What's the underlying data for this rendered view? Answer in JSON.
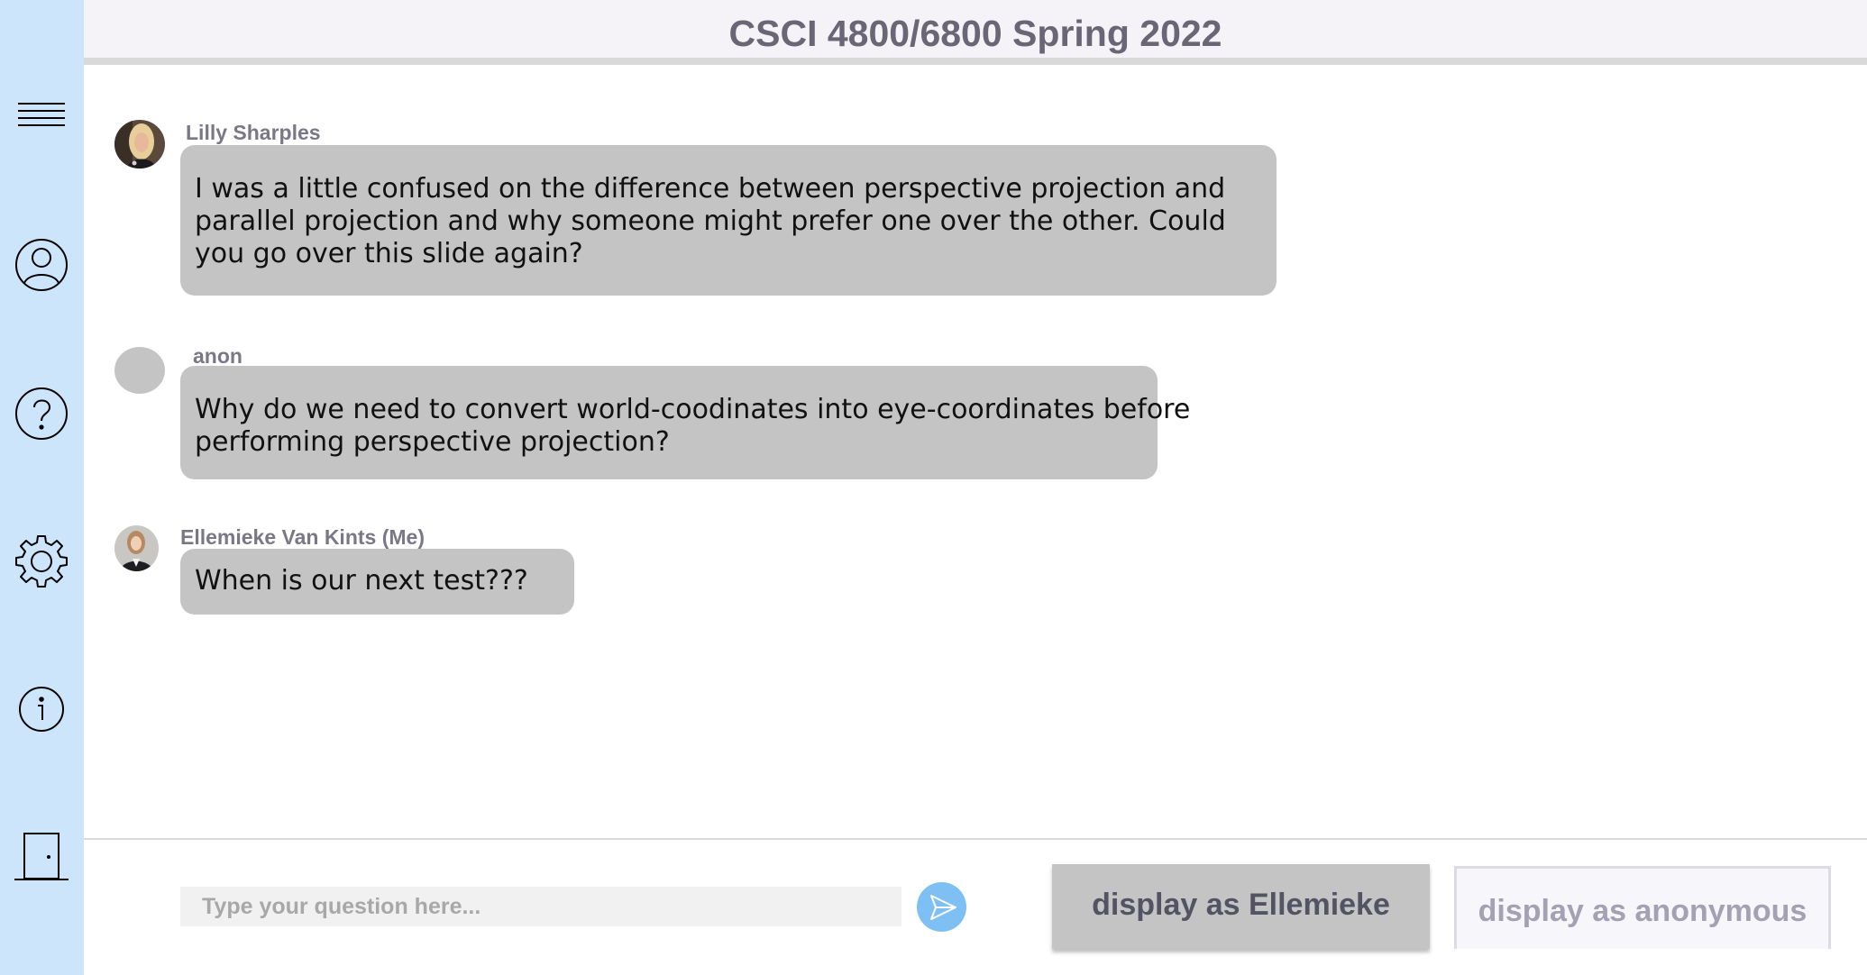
{
  "header": {
    "title": "CSCI 4800/6800 Spring 2022"
  },
  "sidebar": {
    "items": [
      {
        "icon": "menu-icon"
      },
      {
        "icon": "profile-icon"
      },
      {
        "icon": "help-icon"
      },
      {
        "icon": "settings-icon"
      },
      {
        "icon": "info-icon"
      },
      {
        "icon": "exit-door-icon"
      }
    ]
  },
  "messages": [
    {
      "sender": "Lilly Sharples",
      "avatar": "photo",
      "lines": [
        "I was a little confused on the difference between perspective projection and",
        "parallel projection and why someone might prefer one over the other. Could",
        "you go over this slide again?"
      ]
    },
    {
      "sender": "anon",
      "avatar": "blank",
      "lines": [
        "Why do we need to convert world-coodinates into eye-coordinates before",
        "performing perspective projection?"
      ]
    },
    {
      "sender": "Ellemieke Van Kints (Me)",
      "avatar": "photo",
      "lines": [
        "When is our next test???"
      ]
    }
  ],
  "composer": {
    "placeholder": "Type your question here...",
    "value": ""
  },
  "buttons": {
    "display_named": "display as Ellemieke",
    "display_anonymous": "display as anonymous"
  },
  "colors": {
    "sidebar": "#cde5fb",
    "header": "#f6f3f8",
    "bubble": "#c4c4c4",
    "send_button": "#7ec0f3"
  }
}
